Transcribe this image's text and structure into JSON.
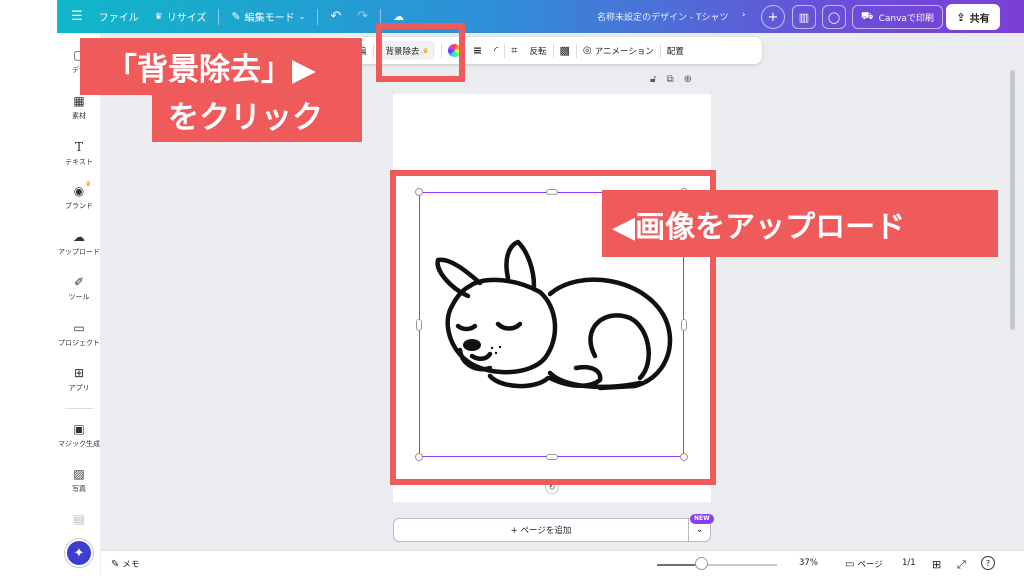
{
  "topbar": {
    "file": "ファイル",
    "resize": "リサイズ",
    "edit_mode": "編集モード",
    "doc_title": "名称未設定のデザイン - Tシャツ",
    "print_label": "Canvaで印刷",
    "share_label": "共有"
  },
  "sidebar": {
    "items": [
      {
        "label": "デザ",
        "icon": "layout-icon"
      },
      {
        "label": "素材",
        "icon": "elements-icon"
      },
      {
        "label": "テキスト",
        "icon": "text-icon"
      },
      {
        "label": "ブランド",
        "icon": "brand-icon"
      },
      {
        "label": "アップロード",
        "icon": "upload-icon"
      },
      {
        "label": "ツール",
        "icon": "pen-icon"
      },
      {
        "label": "プロジェクト",
        "icon": "folder-icon"
      },
      {
        "label": "アプリ",
        "icon": "apps-icon"
      },
      {
        "label": "マジック生成",
        "icon": "magic-media-icon"
      },
      {
        "label": "写真",
        "icon": "photo-icon"
      }
    ]
  },
  "toolbar": {
    "edit": "編",
    "bg_remove": "背景除去",
    "flip": "反転",
    "animation": "アニメーション",
    "position": "配置"
  },
  "canvas": {
    "add_page": "+ ページを追加",
    "new_badge": "NEW"
  },
  "bottombar": {
    "memo": "メモ",
    "zoom": "37%",
    "zoom_fraction": 0.37,
    "page_label": "ページ",
    "page_count": "1/1",
    "help": "?"
  },
  "annotations": {
    "callout_bg_line1": "「背景除去」▶",
    "callout_bg_line2": "をクリック",
    "callout_upload": "◀画像をアップロード",
    "color": "#ef5b5b"
  },
  "colors": {
    "accent": "#8b3dff",
    "magic": "#3c3ecf",
    "topbar_start": "#10b7c8",
    "topbar_end": "#7b3fd6"
  }
}
